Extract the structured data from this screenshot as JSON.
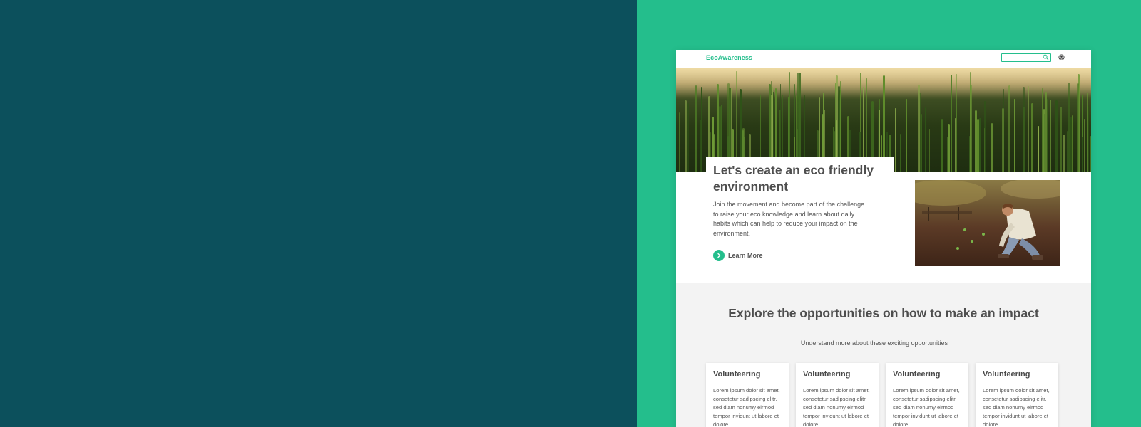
{
  "nav": {
    "logo": "EcoAwareness",
    "search_placeholder": ""
  },
  "hero": {
    "title": "Let's create an eco friendly environment",
    "text": "Join the movement and become part of the challenge to raise your eco knowledge and learn about daily habits which can help to reduce your impact on the environment.",
    "cta_label": "Learn More"
  },
  "explore": {
    "title": "Explore the opportunities on how to make an impact",
    "subtitle": "Understand more about these exciting opportunities",
    "cards": [
      {
        "title": "Volunteering",
        "text": "Lorem ipsum dolor sit amet, consetetur sadipscing elitr, sed diam nonumy eirmod tempor invidunt ut labore et dolore"
      },
      {
        "title": "Volunteering",
        "text": "Lorem ipsum dolor sit amet, consetetur sadipscing elitr, sed diam nonumy eirmod tempor invidunt ut labore et dolore"
      },
      {
        "title": "Volunteering",
        "text": "Lorem ipsum dolor sit amet, consetetur sadipscing elitr, sed diam nonumy eirmod tempor invidunt ut labore et dolore"
      },
      {
        "title": "Volunteering",
        "text": "Lorem ipsum dolor sit amet, consetetur sadipscing elitr, sed diam nonumy eirmod tempor invidunt ut labore et dolore"
      }
    ]
  },
  "colors": {
    "left_panel": "#0c505c",
    "right_panel": "#24be8c",
    "accent": "#24be8c",
    "heading": "#4e4e4e"
  },
  "icons": {
    "search": "search-icon",
    "user": "user-icon",
    "cta": "chevron-right-icon"
  }
}
